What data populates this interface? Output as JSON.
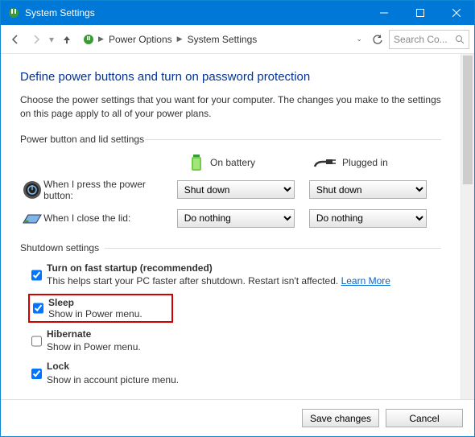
{
  "titlebar": {
    "title": "System Settings"
  },
  "nav": {
    "crumb1": "Power Options",
    "crumb2": "System Settings",
    "search_placeholder": "Search Co..."
  },
  "page": {
    "heading": "Define power buttons and turn on password protection",
    "intro": "Choose the power settings that you want for your computer. The changes you make to the settings on this page apply to all of your power plans.",
    "group_power": "Power button and lid settings",
    "col_battery": "On battery",
    "col_plugged": "Plugged in",
    "row_power_btn": "When I press the power button:",
    "row_lid": "When I close the lid:",
    "sel_power_bat": "Shut down",
    "sel_power_plug": "Shut down",
    "sel_lid_bat": "Do nothing",
    "sel_lid_plug": "Do nothing",
    "group_shutdown": "Shutdown settings",
    "fast_title": "Turn on fast startup (recommended)",
    "fast_desc": "This helps start your PC faster after shutdown. Restart isn't affected. ",
    "fast_link": "Learn More",
    "sleep_title": "Sleep",
    "sleep_desc": "Show in Power menu.",
    "hib_title": "Hibernate",
    "hib_desc": "Show in Power menu.",
    "lock_title": "Lock",
    "lock_desc": "Show in account picture menu."
  },
  "footer": {
    "save": "Save changes",
    "cancel": "Cancel"
  }
}
